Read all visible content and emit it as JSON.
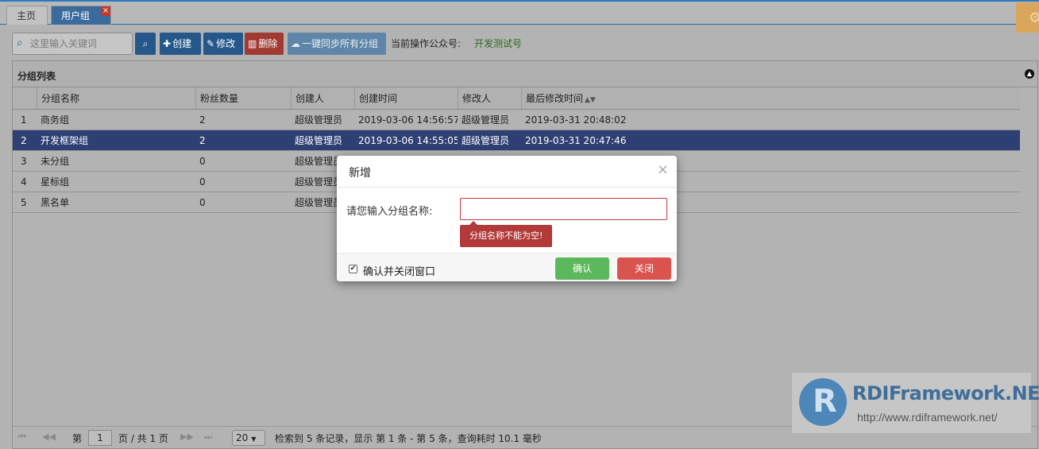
{
  "tabs": {
    "home": "主页",
    "active": "用户组",
    "close": "×"
  },
  "toolbar": {
    "search_placeholder": "这里输入关键词",
    "create": "创建",
    "edit": "修改",
    "delete": "删除",
    "sync": "一键同步所有分组",
    "current_label": "当前操作公众号:",
    "current_value": "开发测试号"
  },
  "panel": {
    "title": "分组列表"
  },
  "grid": {
    "columns": [
      "",
      "分组名称",
      "粉丝数量",
      "创建人",
      "创建时间",
      "修改人",
      "最后修改时间"
    ],
    "rows": [
      {
        "idx": "1",
        "name": "商务组",
        "fans": "2",
        "creator": "超级管理员",
        "created": "2019-03-06 14:56:57",
        "modifier": "超级管理员",
        "modified": "2019-03-31 20:48:02"
      },
      {
        "idx": "2",
        "name": "开发框架组",
        "fans": "2",
        "creator": "超级管理员",
        "created": "2019-03-06 14:55:05",
        "modifier": "超级管理员",
        "modified": "2019-03-31 20:47:46"
      },
      {
        "idx": "3",
        "name": "未分组",
        "fans": "0",
        "creator": "超级管理员",
        "created": "",
        "modifier": "",
        "modified": ""
      },
      {
        "idx": "4",
        "name": "星标组",
        "fans": "0",
        "creator": "超级管理员",
        "created": "",
        "modifier": "",
        "modified": ""
      },
      {
        "idx": "5",
        "name": "黑名单",
        "fans": "0",
        "creator": "超级管理员",
        "created": "",
        "modifier": "",
        "modified": ""
      }
    ],
    "selected_row": 2
  },
  "pager": {
    "page_prefix": "第",
    "page_value": "1",
    "page_suffix": "页 / 共 1 页",
    "page_size": "20",
    "summary": "检索到 5 条记录，显示 第 1 条 - 第 5 条，查询耗时 10.1 毫秒"
  },
  "dialog": {
    "title": "新增",
    "label": "请您输入分组名称:",
    "input_value": "",
    "error": "分组名称不能为空!",
    "checkbox_label": "确认并关闭窗口",
    "checkbox_checked": true,
    "ok": "确认",
    "close": "关闭"
  },
  "brand": {
    "logo_letter": "R",
    "name": "RDIFramework.NET",
    "url": "http://www.rdiframework.net/"
  },
  "icons": {
    "search": "search-icon",
    "create": "plus-icon",
    "edit": "edit-icon",
    "delete": "trash-icon",
    "sync": "cloud-upload-icon",
    "gear": "gear-icon",
    "collapse": "collapse-icon",
    "sort": "sort-icon",
    "first": "first-page-icon",
    "prev": "prev-page-icon",
    "next": "next-page-icon",
    "last": "last-page-icon",
    "dialog_close": "close-icon"
  },
  "colors": {
    "accent": "#25578a",
    "danger": "#a13a33",
    "selected_row": "#2e3f73",
    "ok": "#5cb85c",
    "cancel": "#d9534f"
  }
}
